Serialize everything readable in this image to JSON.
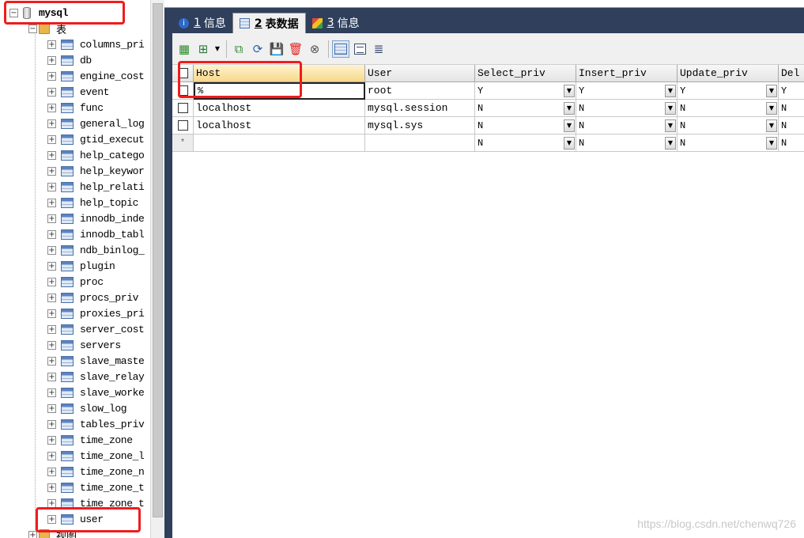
{
  "tree": {
    "db_name": "mysql",
    "tables_folder": "表",
    "views_folder": "视图",
    "tables": [
      "columns_pri",
      "db",
      "engine_cost",
      "event",
      "func",
      "general_log",
      "gtid_execut",
      "help_catego",
      "help_keywor",
      "help_relati",
      "help_topic",
      "innodb_inde",
      "innodb_tabl",
      "ndb_binlog_",
      "plugin",
      "proc",
      "procs_priv",
      "proxies_pri",
      "server_cost",
      "servers",
      "slave_maste",
      "slave_relay",
      "slave_worke",
      "slow_log",
      "tables_priv",
      "time_zone",
      "time_zone_l",
      "time_zone_n",
      "time_zone_t",
      "time_zone_t",
      "user"
    ]
  },
  "tabs": [
    {
      "num": "1",
      "label": "信息"
    },
    {
      "num": "2",
      "label": "表数据"
    },
    {
      "num": "3",
      "label": "信息"
    }
  ],
  "grid": {
    "columns": [
      "Host",
      "User",
      "Select_priv",
      "Insert_priv",
      "Update_priv",
      "Del"
    ],
    "rows": [
      {
        "host": "%",
        "user": "root",
        "select": "Y",
        "insert": "Y",
        "update": "Y",
        "del": "Y"
      },
      {
        "host": "localhost",
        "user": "mysql.session",
        "select": "N",
        "insert": "N",
        "update": "N",
        "del": "N"
      },
      {
        "host": "localhost",
        "user": "mysql.sys",
        "select": "N",
        "insert": "N",
        "update": "N",
        "del": "N"
      }
    ],
    "new_row": {
      "marker": "*",
      "select": "N",
      "insert": "N",
      "update": "N",
      "del": "N"
    }
  },
  "icons": {
    "dropdown": "▼",
    "expand": "+",
    "collapse": "−",
    "info": "i"
  },
  "watermark": "https://blog.csdn.net/chenwq726"
}
